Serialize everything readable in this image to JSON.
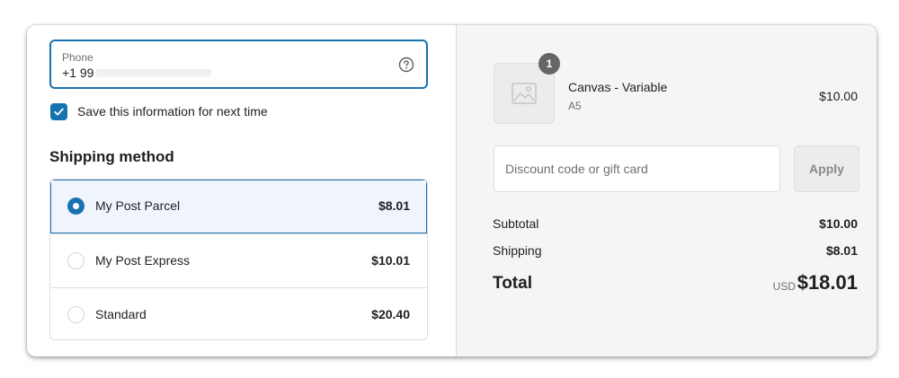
{
  "contact": {
    "phone_label": "Phone",
    "phone_value": "+1 99",
    "help_icon": "question-circle-icon",
    "save_info_label": "Save this information for next time",
    "save_info_checked": true
  },
  "shipping": {
    "title": "Shipping method",
    "options": [
      {
        "name": "My Post Parcel",
        "price": "$8.01",
        "selected": true
      },
      {
        "name": "My Post Express",
        "price": "$10.01",
        "selected": false
      },
      {
        "name": "Standard",
        "price": "$20.40",
        "selected": false
      }
    ]
  },
  "order": {
    "item": {
      "quantity": "1",
      "name": "Canvas - Variable",
      "variant": "A5",
      "price": "$10.00",
      "image_icon": "image-placeholder-icon"
    },
    "discount": {
      "placeholder": "Discount code or gift card",
      "apply_label": "Apply"
    },
    "subtotal_label": "Subtotal",
    "subtotal_value": "$10.00",
    "shipping_label": "Shipping",
    "shipping_value": "$8.01",
    "total_label": "Total",
    "total_currency": "USD",
    "total_value": "$18.01"
  },
  "colors": {
    "accent": "#1773b0",
    "selected_bg": "#f0f5fd",
    "summary_bg": "#f5f5f5"
  }
}
